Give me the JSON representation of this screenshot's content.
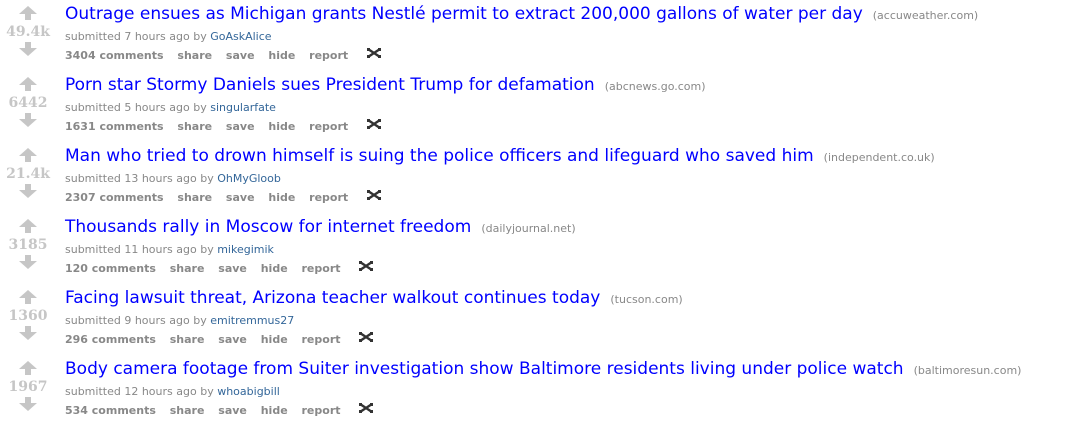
{
  "posts": [
    {
      "score": "49.4k",
      "title": "Outrage ensues as Michigan grants Nestlé permit to extract 200,000 gallons of water per day",
      "domain": "(accuweather.com)",
      "submitted_prefix": "submitted",
      "time": "7 hours ago",
      "by": "by",
      "author": "GoAskAlice",
      "comments": "3404 comments",
      "share": "share",
      "save": "save",
      "hide": "hide",
      "report": "report"
    },
    {
      "score": "6442",
      "title": "Porn star Stormy Daniels sues President Trump for defamation",
      "domain": "(abcnews.go.com)",
      "submitted_prefix": "submitted",
      "time": "5 hours ago",
      "by": "by",
      "author": "singularfate",
      "comments": "1631 comments",
      "share": "share",
      "save": "save",
      "hide": "hide",
      "report": "report"
    },
    {
      "score": "21.4k",
      "title": "Man who tried to drown himself is suing the police officers and lifeguard who saved him",
      "domain": "(independent.co.uk)",
      "submitted_prefix": "submitted",
      "time": "13 hours ago",
      "by": "by",
      "author": "OhMyGloob",
      "comments": "2307 comments",
      "share": "share",
      "save": "save",
      "hide": "hide",
      "report": "report"
    },
    {
      "score": "3185",
      "title": "Thousands rally in Moscow for internet freedom",
      "domain": "(dailyjournal.net)",
      "submitted_prefix": "submitted",
      "time": "11 hours ago",
      "by": "by",
      "author": "mikegimik",
      "comments": "120 comments",
      "share": "share",
      "save": "save",
      "hide": "hide",
      "report": "report"
    },
    {
      "score": "1360",
      "title": "Facing lawsuit threat, Arizona teacher walkout continues today",
      "domain": "(tucson.com)",
      "submitted_prefix": "submitted",
      "time": "9 hours ago",
      "by": "by",
      "author": "emitremmus27",
      "comments": "296 comments",
      "share": "share",
      "save": "save",
      "hide": "hide",
      "report": "report"
    },
    {
      "score": "1967",
      "title": "Body camera footage from Suiter investigation show Baltimore residents living under police watch",
      "domain": "(baltimoresun.com)",
      "submitted_prefix": "submitted",
      "time": "12 hours ago",
      "by": "by",
      "author": "whoabigbill",
      "comments": "534 comments",
      "share": "share",
      "save": "save",
      "hide": "hide",
      "report": "report"
    }
  ],
  "colors": {
    "title": "#0000ff",
    "author": "#336699",
    "meta": "#888888",
    "score": "#c6c6c6",
    "arrow": "#c6c6c6"
  },
  "icons": {
    "upvote": "upvote-arrow-icon",
    "downvote": "downvote-arrow-icon",
    "crosspost": "crosspost-icon"
  }
}
